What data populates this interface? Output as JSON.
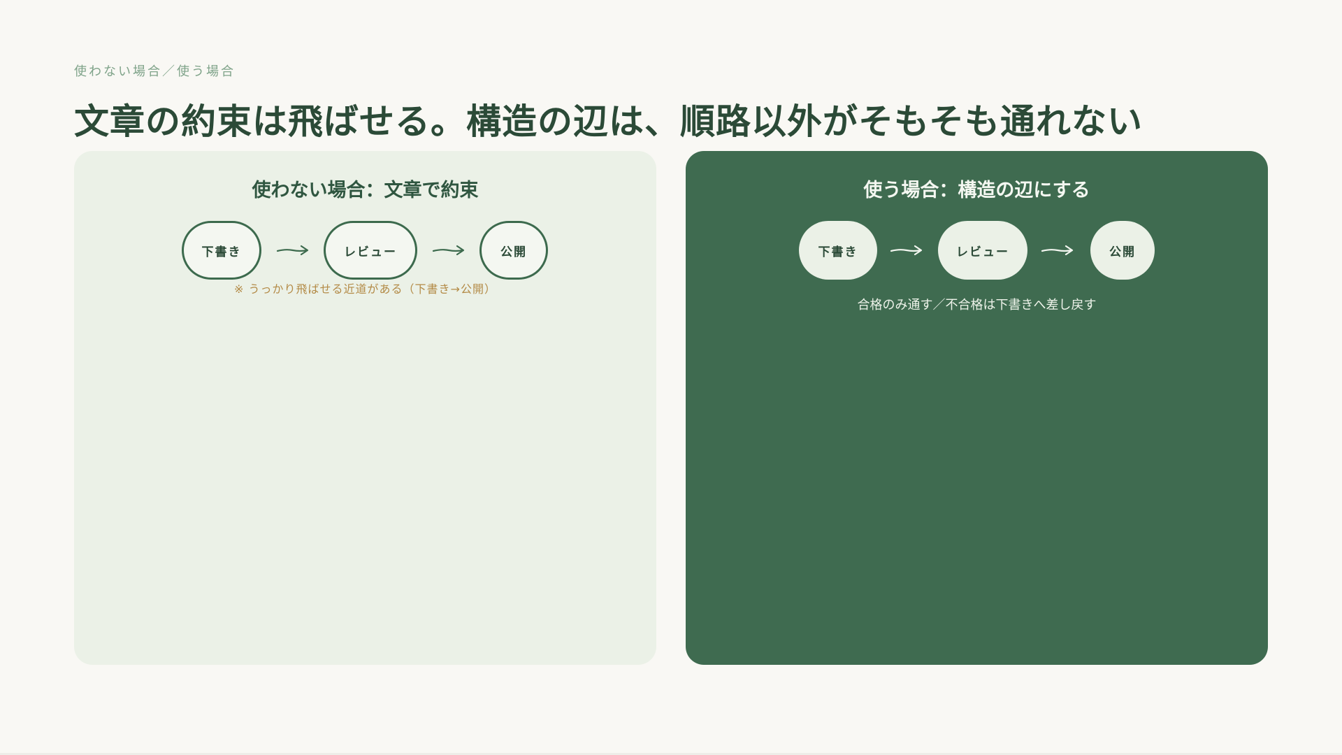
{
  "header": {
    "eyebrow": "使わない場合／使う場合",
    "title": "文章の約束は飛ばせる。構造の辺は、順路以外がそもそも通れない"
  },
  "left_panel": {
    "title": "使わない場合：文章で約束",
    "nodes": [
      "下書き",
      "レビュー",
      "公開"
    ],
    "note": "※ うっかり飛ばせる近道がある（下書き→公開）"
  },
  "right_panel": {
    "title": "使う場合：構造の辺にする",
    "nodes": [
      "下書き",
      "レビュー",
      "公開"
    ],
    "note": "合格のみ通す／不合格は下書きへ差し戻す"
  },
  "colors": {
    "background": "#f9f8f4",
    "left_panel": "#ebf1e7",
    "right_panel": "#3f6b50",
    "accent_green": "#3c6a4d",
    "warning_note": "#b38a46"
  }
}
